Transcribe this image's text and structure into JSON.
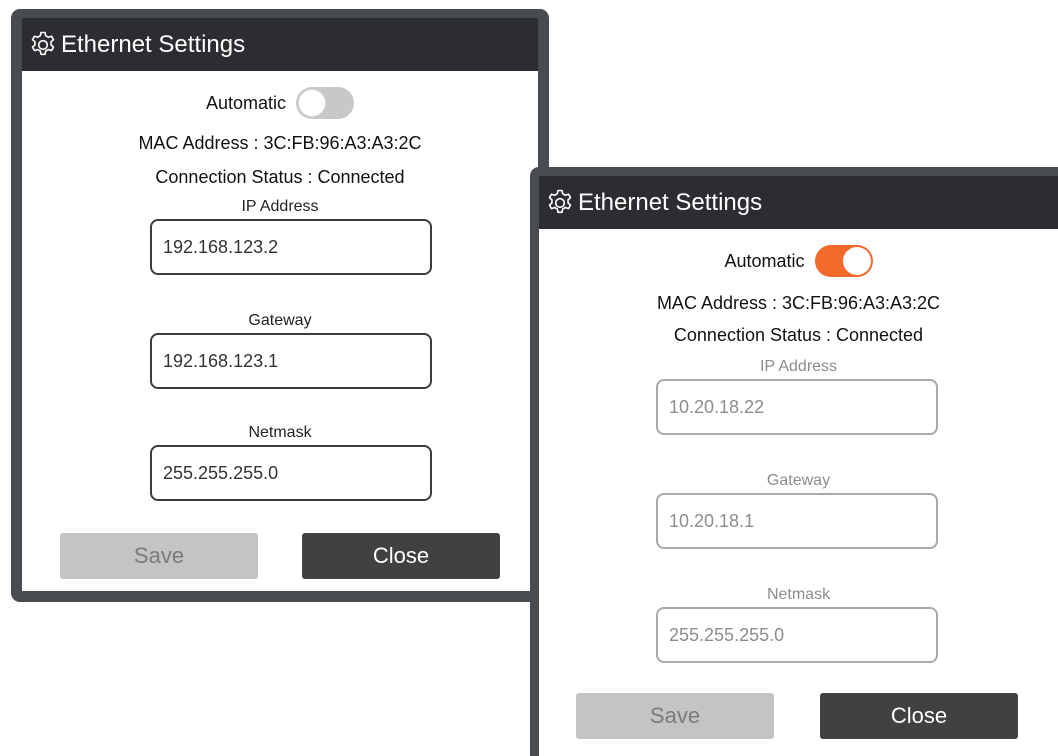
{
  "dialogs": [
    {
      "title": "Ethernet Settings",
      "automatic_label": "Automatic",
      "automatic_enabled": false,
      "mac_address": "MAC Address : 3C:FB:96:A3:A3:2C",
      "connection_status": "Connection Status : Connected",
      "fields": {
        "ip": {
          "label": "IP Address",
          "value": "192.168.123.2"
        },
        "gateway": {
          "label": "Gateway",
          "value": "192.168.123.1"
        },
        "netmask": {
          "label": "Netmask",
          "value": "255.255.255.0"
        }
      },
      "save_label": "Save",
      "close_label": "Close"
    },
    {
      "title": "Ethernet Settings",
      "automatic_label": "Automatic",
      "automatic_enabled": true,
      "mac_address": "MAC Address : 3C:FB:96:A3:A3:2C",
      "connection_status": "Connection Status : Connected",
      "fields": {
        "ip": {
          "label": "IP Address",
          "value": "10.20.18.22"
        },
        "gateway": {
          "label": "Gateway",
          "value": "10.20.18.1"
        },
        "netmask": {
          "label": "Netmask",
          "value": "255.255.255.0"
        }
      },
      "save_label": "Save",
      "close_label": "Close"
    }
  ],
  "colors": {
    "titlebar": "#2b2d31",
    "frame": "#484b50",
    "toggle_on": "#f26a2a",
    "toggle_off": "#c8c8c8",
    "save_disabled": "#c4c4c4",
    "close_button": "#414141"
  },
  "icons": {
    "title_icon": "gear-icon"
  }
}
